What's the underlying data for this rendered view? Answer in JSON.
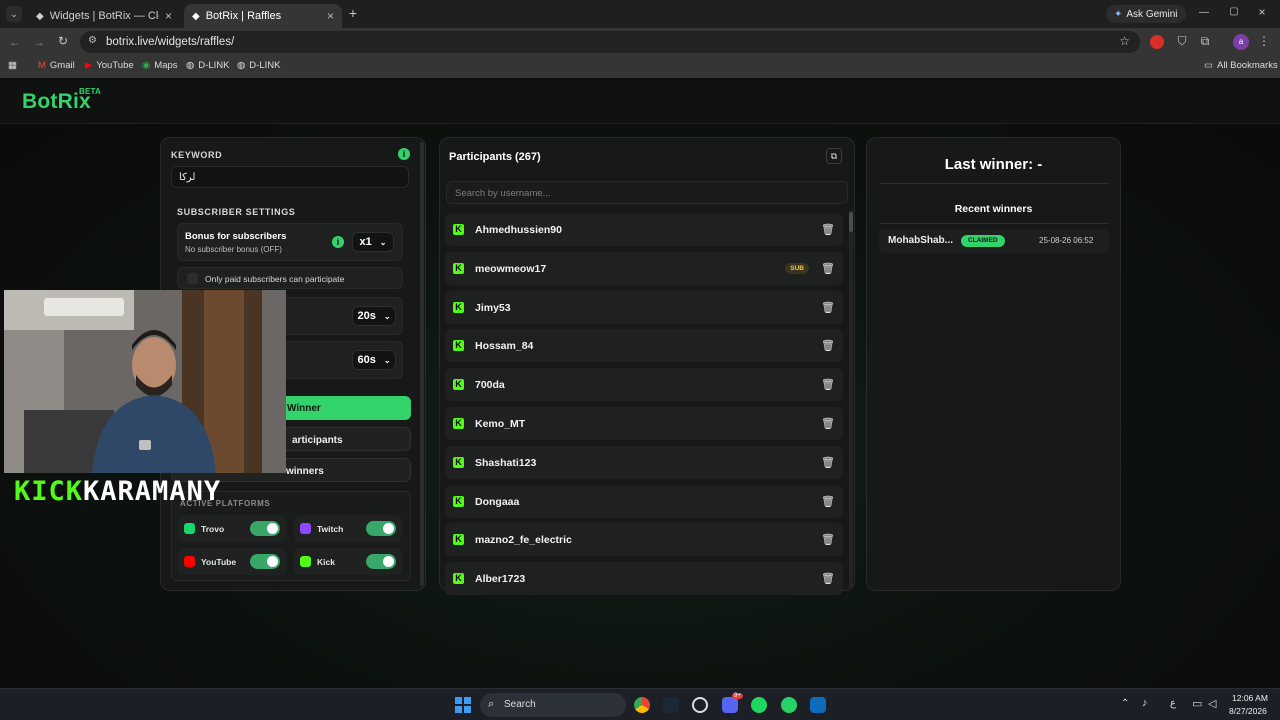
{
  "browser": {
    "tabs": [
      {
        "title": "Widgets | BotRix — Cloud Strea"
      },
      {
        "title": "BotRix | Raffles"
      }
    ],
    "new_tab": "+",
    "ask_gemini": "Ask Gemini",
    "url": "botrix.live/widgets/raffles/",
    "bookmarks": [
      "Gmail",
      "YouTube",
      "Maps",
      "D-LINK",
      "D-LINK"
    ],
    "all_bookmarks": "All Bookmarks"
  },
  "app": {
    "logo": "BotRix",
    "logo_badge": "BETA"
  },
  "settings": {
    "keyword_label": "KEYWORD",
    "keyword_value": "لركا",
    "subscriber_settings_label": "SUBSCRIBER SETTINGS",
    "bonus_title": "Bonus for subscribers",
    "bonus_subtitle": "No subscriber bonus (OFF)",
    "bonus_multiplier": "x1",
    "only_paid_label": "Only paid subscribers can participate",
    "timer1": "20s",
    "timer2": "60s",
    "pick_winner_label": "Winner",
    "participants_btn_label": "articipants",
    "winners_btn_label": "winners",
    "active_platforms_label": "ACTIVE PLATFORMS",
    "platforms": [
      {
        "name": "Trovo",
        "color": "#19d66b"
      },
      {
        "name": "Twitch",
        "color": "#9146ff"
      },
      {
        "name": "YouTube",
        "color": "#ff0000"
      },
      {
        "name": "Kick",
        "color": "#53fc18"
      }
    ]
  },
  "participants": {
    "title": "Participants (267)",
    "search_placeholder": "Search by username...",
    "list": [
      {
        "username": "Ahmedhussien90",
        "sub": ""
      },
      {
        "username": "meowmeow17",
        "sub": "SUB"
      },
      {
        "username": "Jimy53",
        "sub": ""
      },
      {
        "username": "Hossam_84",
        "sub": ""
      },
      {
        "username": "700da",
        "sub": ""
      },
      {
        "username": "Kemo_MT",
        "sub": ""
      },
      {
        "username": "Shashati123",
        "sub": ""
      },
      {
        "username": "Dongaaa",
        "sub": ""
      },
      {
        "username": "mazno2_fe_electric",
        "sub": ""
      },
      {
        "username": "Alber1723",
        "sub": ""
      }
    ]
  },
  "winners": {
    "last_winner": "Last winner: -",
    "recent_title": "Recent winners",
    "recent": [
      {
        "name": "MohabShab...",
        "status": "CLAIMED",
        "date": "25-08-26 06:52"
      }
    ]
  },
  "overlay": {
    "streamer_name_left": "KICK",
    "streamer_name_right": "KARAMANY"
  },
  "taskbar": {
    "search": "Search",
    "time": "12:06 AM",
    "date": "8/27/2026",
    "lang": "ع",
    "badge_count": "9+"
  },
  "colors": {
    "accent": "#33d36b",
    "kick_green": "#53fc18"
  }
}
